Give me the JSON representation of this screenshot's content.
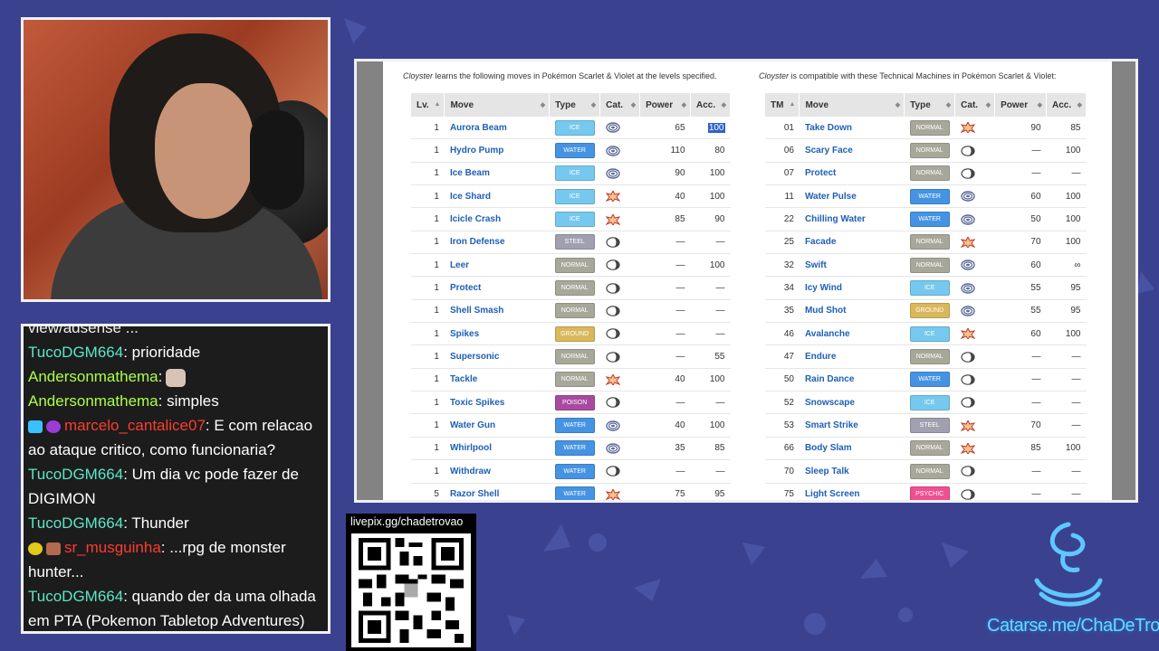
{
  "colors": {
    "background": "#3a4290",
    "chat_bg": "#1c1c1c",
    "panel_border": "#eef0f6",
    "link": "#1e5fb5"
  },
  "chat": {
    "top_partial": "view/adsense ...",
    "messages": [
      {
        "user": "TucoDGM664",
        "text": ": prioridade",
        "color": "teal"
      },
      {
        "user": "Andersonmathema",
        "text": ":",
        "emote": "cat-emote",
        "color": "green"
      },
      {
        "user": "Andersonmathema",
        "text": ": simples",
        "color": "green"
      },
      {
        "user": "marcelo_cantalice07",
        "text": ": E com relacao ao ataque critico, como funcionaria?",
        "color": "red",
        "badges": [
          "crown-badge",
          "heart-badge"
        ]
      },
      {
        "user": "TucoDGM664",
        "text": ": Um dia vc pode fazer de DIGIMON",
        "color": "teal"
      },
      {
        "user": "TucoDGM664",
        "text": ": Thunder",
        "color": "teal"
      },
      {
        "user": "sr_musguinha",
        "text": ": ...rpg de monster hunter...",
        "color": "red",
        "badges": [
          "yellow-badge",
          "face-badge"
        ]
      },
      {
        "user": "TucoDGM664",
        "text": ": quando der da uma olhada em PTA (Pokemon Tabletop Adventures)",
        "color": "teal"
      }
    ]
  },
  "level_table": {
    "caption_pokemon": "Cloyster",
    "caption_rest": " learns the following moves in Pokémon Scarlet & Violet at the levels specified.",
    "headers": [
      "Lv.",
      "Move",
      "Type",
      "Cat.",
      "Power",
      "Acc."
    ],
    "rows": [
      {
        "lv": "1",
        "move": "Aurora Beam",
        "type": "ICE",
        "tcls": "ice",
        "cat": "special",
        "power": "65",
        "acc": "100",
        "hl": true
      },
      {
        "lv": "1",
        "move": "Hydro Pump",
        "type": "WATER",
        "tcls": "water",
        "cat": "special",
        "power": "110",
        "acc": "80"
      },
      {
        "lv": "1",
        "move": "Ice Beam",
        "type": "ICE",
        "tcls": "ice",
        "cat": "special",
        "power": "90",
        "acc": "100"
      },
      {
        "lv": "1",
        "move": "Ice Shard",
        "type": "ICE",
        "tcls": "ice",
        "cat": "physical",
        "power": "40",
        "acc": "100"
      },
      {
        "lv": "1",
        "move": "Icicle Crash",
        "type": "ICE",
        "tcls": "ice",
        "cat": "physical",
        "power": "85",
        "acc": "90"
      },
      {
        "lv": "1",
        "move": "Iron Defense",
        "type": "STEEL",
        "tcls": "steel",
        "cat": "status",
        "power": "—",
        "acc": "—"
      },
      {
        "lv": "1",
        "move": "Leer",
        "type": "NORMAL",
        "tcls": "normal",
        "cat": "status",
        "power": "—",
        "acc": "100"
      },
      {
        "lv": "1",
        "move": "Protect",
        "type": "NORMAL",
        "tcls": "normal",
        "cat": "status",
        "power": "—",
        "acc": "—"
      },
      {
        "lv": "1",
        "move": "Shell Smash",
        "type": "NORMAL",
        "tcls": "normal",
        "cat": "status",
        "power": "—",
        "acc": "—"
      },
      {
        "lv": "1",
        "move": "Spikes",
        "type": "GROUND",
        "tcls": "ground",
        "cat": "status",
        "power": "—",
        "acc": "—"
      },
      {
        "lv": "1",
        "move": "Supersonic",
        "type": "NORMAL",
        "tcls": "normal",
        "cat": "status",
        "power": "—",
        "acc": "55"
      },
      {
        "lv": "1",
        "move": "Tackle",
        "type": "NORMAL",
        "tcls": "normal",
        "cat": "physical",
        "power": "40",
        "acc": "100"
      },
      {
        "lv": "1",
        "move": "Toxic Spikes",
        "type": "POISON",
        "tcls": "poison",
        "cat": "status",
        "power": "—",
        "acc": "—"
      },
      {
        "lv": "1",
        "move": "Water Gun",
        "type": "WATER",
        "tcls": "water",
        "cat": "special",
        "power": "40",
        "acc": "100"
      },
      {
        "lv": "1",
        "move": "Whirlpool",
        "type": "WATER",
        "tcls": "water",
        "cat": "special",
        "power": "35",
        "acc": "85"
      },
      {
        "lv": "1",
        "move": "Withdraw",
        "type": "WATER",
        "tcls": "water",
        "cat": "status",
        "power": "—",
        "acc": "—"
      },
      {
        "lv": "5",
        "move": "Razor Shell",
        "type": "WATER",
        "tcls": "water",
        "cat": "physical",
        "power": "75",
        "acc": "95"
      }
    ]
  },
  "tm_table": {
    "caption_pokemon": "Cloyster",
    "caption_rest": " is compatible with these Technical Machines in Pokémon Scarlet & Violet:",
    "headers": [
      "TM",
      "Move",
      "Type",
      "Cat.",
      "Power",
      "Acc."
    ],
    "rows": [
      {
        "tm": "01",
        "move": "Take Down",
        "type": "NORMAL",
        "tcls": "normal",
        "cat": "physical",
        "power": "90",
        "acc": "85"
      },
      {
        "tm": "06",
        "move": "Scary Face",
        "type": "NORMAL",
        "tcls": "normal",
        "cat": "status",
        "power": "—",
        "acc": "100"
      },
      {
        "tm": "07",
        "move": "Protect",
        "type": "NORMAL",
        "tcls": "normal",
        "cat": "status",
        "power": "—",
        "acc": "—"
      },
      {
        "tm": "11",
        "move": "Water Pulse",
        "type": "WATER",
        "tcls": "water",
        "cat": "special",
        "power": "60",
        "acc": "100"
      },
      {
        "tm": "22",
        "move": "Chilling Water",
        "type": "WATER",
        "tcls": "water",
        "cat": "special",
        "power": "50",
        "acc": "100"
      },
      {
        "tm": "25",
        "move": "Facade",
        "type": "NORMAL",
        "tcls": "normal",
        "cat": "physical",
        "power": "70",
        "acc": "100"
      },
      {
        "tm": "32",
        "move": "Swift",
        "type": "NORMAL",
        "tcls": "normal",
        "cat": "special",
        "power": "60",
        "acc": "∞"
      },
      {
        "tm": "34",
        "move": "Icy Wind",
        "type": "ICE",
        "tcls": "ice",
        "cat": "special",
        "power": "55",
        "acc": "95"
      },
      {
        "tm": "35",
        "move": "Mud Shot",
        "type": "GROUND",
        "tcls": "ground",
        "cat": "special",
        "power": "55",
        "acc": "95"
      },
      {
        "tm": "46",
        "move": "Avalanche",
        "type": "ICE",
        "tcls": "ice",
        "cat": "physical",
        "power": "60",
        "acc": "100"
      },
      {
        "tm": "47",
        "move": "Endure",
        "type": "NORMAL",
        "tcls": "normal",
        "cat": "status",
        "power": "—",
        "acc": "—"
      },
      {
        "tm": "50",
        "move": "Rain Dance",
        "type": "WATER",
        "tcls": "water",
        "cat": "status",
        "power": "—",
        "acc": "—"
      },
      {
        "tm": "52",
        "move": "Snowscape",
        "type": "ICE",
        "tcls": "ice",
        "cat": "status",
        "power": "—",
        "acc": "—"
      },
      {
        "tm": "53",
        "move": "Smart Strike",
        "type": "STEEL",
        "tcls": "steel",
        "cat": "physical",
        "power": "70",
        "acc": "—"
      },
      {
        "tm": "66",
        "move": "Body Slam",
        "type": "NORMAL",
        "tcls": "normal",
        "cat": "physical",
        "power": "85",
        "acc": "100"
      },
      {
        "tm": "70",
        "move": "Sleep Talk",
        "type": "NORMAL",
        "tcls": "normal",
        "cat": "status",
        "power": "—",
        "acc": "—"
      },
      {
        "tm": "75",
        "move": "Light Screen",
        "type": "PSYCHIC",
        "tcls": "psychic",
        "cat": "status",
        "power": "—",
        "acc": "—"
      }
    ]
  },
  "qr": {
    "label": "livepix.gg/chadetrovao"
  },
  "footer": {
    "catarse": "Catarse.me/ChaDeTrovao"
  }
}
